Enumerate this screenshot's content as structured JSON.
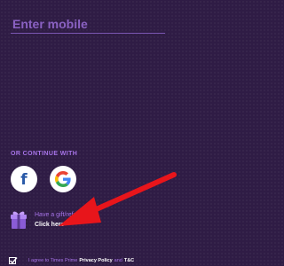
{
  "mobile_input": {
    "placeholder": "Enter mobile",
    "value": ""
  },
  "social": {
    "label": "OR CONTINUE WITH",
    "facebook_glyph": "f",
    "facebook_icon": "facebook-icon",
    "google_icon": "google-icon"
  },
  "gift": {
    "icon": "gift-icon",
    "title": "Have a gift/referral",
    "link": "Click here"
  },
  "consent": {
    "checked": true,
    "prefix": "I agree to Times Prime",
    "privacy_link": "Privacy Policy",
    "and": "and",
    "tc_link": "T&C"
  },
  "colors": {
    "background": "#2f1c45",
    "accent": "#a774e8",
    "annotation_arrow": "#e8151b"
  }
}
